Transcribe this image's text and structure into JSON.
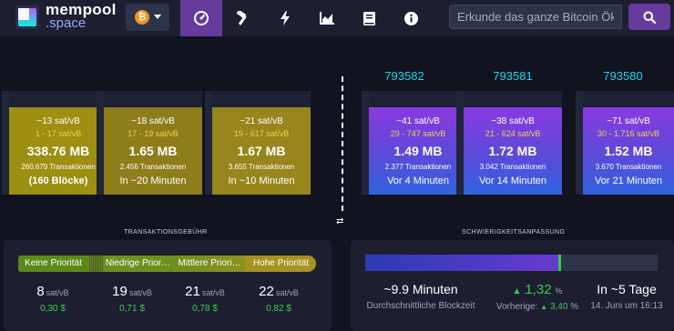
{
  "header": {
    "logo_line1": "mempool",
    "logo_line2": ".space",
    "network_symbol": "₿",
    "search_placeholder": "Erkunde das ganze Bitcoin Ökosystem",
    "nav_icons": [
      "dashboard-gauge-icon",
      "hammer-icon",
      "lightning-icon",
      "chart-icon",
      "book-icon",
      "info-icon"
    ],
    "colors": {
      "active": "#653b9c",
      "bar": "#1d1f31",
      "accent_cyan": "#1bd8f4"
    }
  },
  "mempool_blocks": [
    {
      "fee": "~13 sat/vB",
      "range": "1 - 17 sat/vB",
      "size": "338.76 MB",
      "tx": "260.679 Transaktionen",
      "time": "(160 Blöcke)"
    },
    {
      "fee": "~18 sat/vB",
      "range": "17 - 19 sat/vB",
      "size": "1.65 MB",
      "tx": "2.456 Transaktionen",
      "time": "In ~20 Minuten"
    },
    {
      "fee": "~21 sat/vB",
      "range": "19 - 617 sat/vB",
      "size": "1.67 MB",
      "tx": "3.655 Transaktionen",
      "time": "In ~10 Minuten"
    }
  ],
  "mined_blocks": [
    {
      "height": "793582",
      "fee": "~41 sat/vB",
      "range": "29 - 747 sat/vB",
      "size": "1.49 MB",
      "tx": "2.377 Transaktionen",
      "time": "Vor 4 Minuten"
    },
    {
      "height": "793581",
      "fee": "~38 sat/vB",
      "range": "21 - 624 sat/vB",
      "size": "1.72 MB",
      "tx": "3.042 Transaktionen",
      "time": "Vor 14 Minuten"
    },
    {
      "height": "793580",
      "fee": "~71 sat/vB",
      "range": "30 - 1.716 sat/vB",
      "size": "1.52 MB",
      "tx": "3.670 Transaktionen",
      "time": "Vor 21 Minuten"
    }
  ],
  "fees": {
    "title": "TRANSAKTIONSGEBÜHR",
    "priorities": [
      "Keine Priorität",
      "Niedrige Prior…",
      "Mittlere Priori…",
      "Hohe Priorität"
    ],
    "values": [
      {
        "num": "8",
        "unit": "sat/vB",
        "usd": "0,30 $"
      },
      {
        "num": "19",
        "unit": "sat/vB",
        "usd": "0,71 $"
      },
      {
        "num": "21",
        "unit": "sat/vB",
        "usd": "0,78 $"
      },
      {
        "num": "22",
        "unit": "sat/vB",
        "usd": "0,82 $"
      }
    ]
  },
  "difficulty": {
    "title": "SCHWIERIGKEITSANPASSUNG",
    "progress": 0.66,
    "avg_time": "~9.9 Minuten",
    "avg_label": "Durchschnittliche Blockzeit",
    "change_arrow": "▲",
    "change": "1,32",
    "change_unit": "%",
    "previous_prefix": "Vorherige:",
    "previous_arrow": "▲",
    "previous_value": "3,40",
    "previous_unit": "%",
    "eta": "In ~5 Tage",
    "eta_date": "14. Juni um 16:13"
  },
  "swap_icon": "⇄"
}
